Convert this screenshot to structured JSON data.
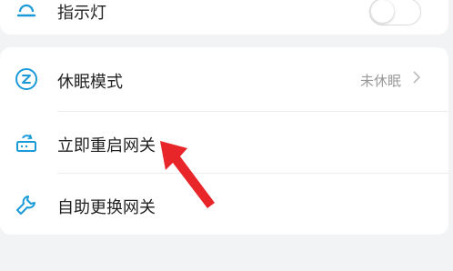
{
  "indicator": {
    "label": "指示灯",
    "toggle_on": false,
    "icon": "bell-icon"
  },
  "sleep": {
    "label": "休眠模式",
    "value": "未休眠",
    "icon": "sleep-z-icon"
  },
  "restart": {
    "label": "立即重启网关",
    "icon": "router-restart-icon"
  },
  "replace": {
    "label": "自助更换网关",
    "icon": "wrench-icon"
  },
  "colors": {
    "accent": "#1a9bd7",
    "arrow": "#e8262a"
  }
}
